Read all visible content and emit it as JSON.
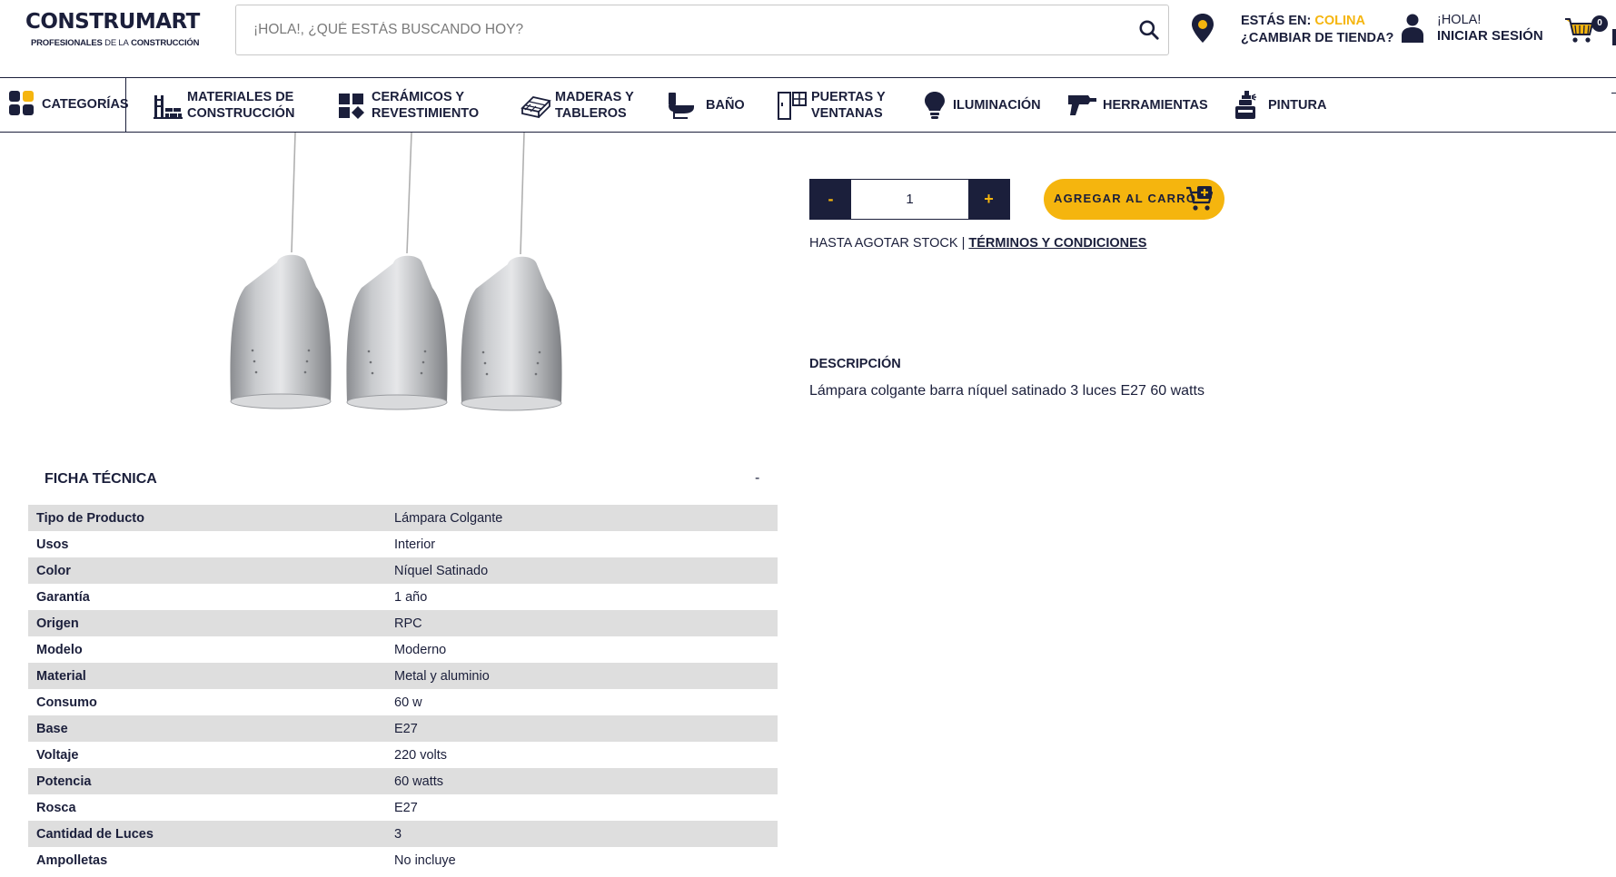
{
  "header": {
    "logo": {
      "brand": "CONSTRUMART",
      "tagline_bold": "PROFESIONALES",
      "tagline_light": "DE LA",
      "tagline_end": "CONSTRUCCIÓN"
    },
    "search": {
      "placeholder": "¡HOLA!, ¿QUÉ ESTÁS BUSCANDO HOY?",
      "value": "",
      "icon": "search-icon"
    },
    "store": {
      "prefix": "ESTÁS EN:",
      "name": "COLINA",
      "change_label": "¿CAMBIAR DE TIENDA?",
      "icon": "location-pin-icon"
    },
    "user": {
      "greeting": "¡HOLA!",
      "login_label": "INICIAR SESIÓN",
      "icon": "user-icon"
    },
    "cart": {
      "count": "0",
      "icon": "cart-icon"
    }
  },
  "nav": {
    "categories_label": "CATEGORÍAS",
    "items": [
      {
        "label": "MATERIALES DE\nCONSTRUCCIÓN",
        "icon": "bricks-icon"
      },
      {
        "label": "CERÁMICOS Y\nREVESTIMIENTO",
        "icon": "tiles-icon"
      },
      {
        "label": "MADERAS Y\nTABLEROS",
        "icon": "wood-boards-icon"
      },
      {
        "label": "BAÑO",
        "icon": "toilet-icon"
      },
      {
        "label": "PUERTAS Y\nVENTANAS",
        "icon": "door-window-icon"
      },
      {
        "label": "ILUMINACIÓN",
        "icon": "lightbulb-icon"
      },
      {
        "label": "HERRAMIENTAS",
        "icon": "drill-icon"
      },
      {
        "label": "PINTURA",
        "icon": "paint-spray-icon"
      }
    ]
  },
  "purchase": {
    "minus_label": "-",
    "plus_label": "+",
    "quantity": "1",
    "add_to_cart_label": "AGREGAR AL CARRO",
    "stock_text": "HASTA AGOTAR STOCK |",
    "terms_label": "TÉRMINOS Y CONDICIONES"
  },
  "colors": {
    "primary": "#1b1f3b",
    "accent": "#f5b50e",
    "row_alt": "#dedede"
  },
  "description": {
    "title": "DESCRIPCIÓN",
    "text": "Lámpara colgante barra níquel satinado 3 luces E27 60 watts"
  },
  "spec": {
    "title": "FICHA TÉCNICA",
    "toggle_label": "-",
    "rows": [
      {
        "key": "Tipo de Producto",
        "value": "Lámpara Colgante"
      },
      {
        "key": "Usos",
        "value": "Interior"
      },
      {
        "key": "Color",
        "value": "Níquel Satinado"
      },
      {
        "key": "Garantía",
        "value": "1 año"
      },
      {
        "key": "Origen",
        "value": "RPC"
      },
      {
        "key": "Modelo",
        "value": "Moderno"
      },
      {
        "key": "Material",
        "value": "Metal y aluminio"
      },
      {
        "key": "Consumo",
        "value": "60 w"
      },
      {
        "key": "Base",
        "value": "E27"
      },
      {
        "key": "Voltaje",
        "value": "220 volts"
      },
      {
        "key": "Potencia",
        "value": "60 watts"
      },
      {
        "key": "Rosca",
        "value": "E27"
      },
      {
        "key": "Cantidad de Luces",
        "value": "3"
      },
      {
        "key": "Ampolletas",
        "value": "No incluye"
      }
    ]
  }
}
